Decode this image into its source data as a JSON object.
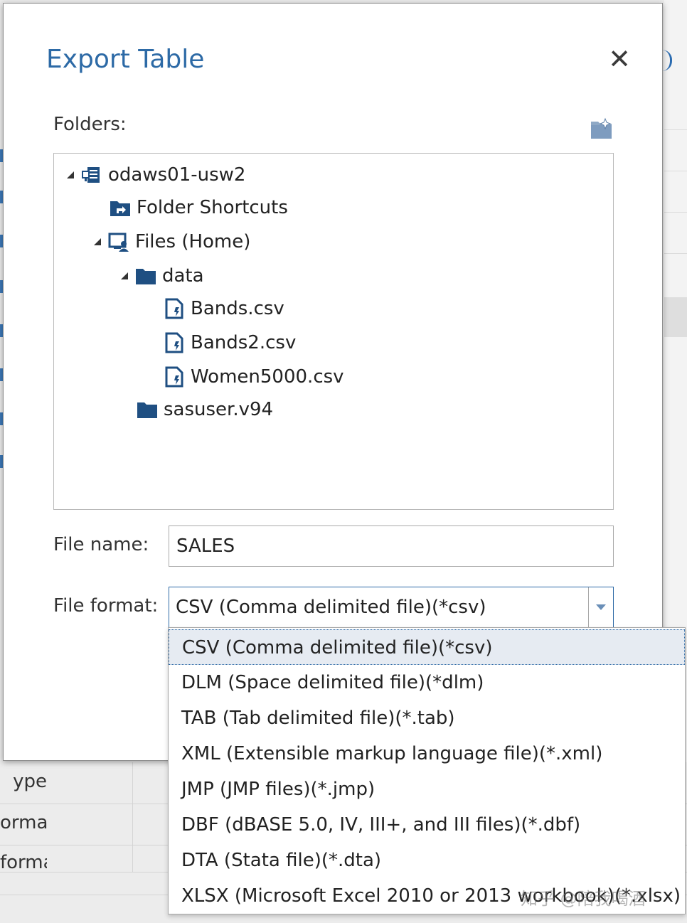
{
  "dialog": {
    "title": "Export Table",
    "close_symbol": "✕",
    "folders_label": "Folders:",
    "new_folder_icon": "new-folder-icon"
  },
  "tree": [
    {
      "label": "odaws01-usw2",
      "icon": "server-icon",
      "expanded": true
    },
    {
      "label": "Folder Shortcuts",
      "icon": "folder-shortcut-icon"
    },
    {
      "label": "Files (Home)",
      "icon": "home-files-icon",
      "expanded": true
    },
    {
      "label": "data",
      "icon": "folder-icon",
      "expanded": true
    },
    {
      "label": "Bands.csv",
      "icon": "file-icon"
    },
    {
      "label": "Bands2.csv",
      "icon": "file-icon"
    },
    {
      "label": "Women5000.csv",
      "icon": "file-icon"
    },
    {
      "label": "sasuser.v94",
      "icon": "folder-icon"
    }
  ],
  "file_name": {
    "label": "File name:",
    "value": "SALES"
  },
  "file_format": {
    "label": "File format:",
    "selected": "CSV (Comma delimited file)(*csv)",
    "options": [
      "CSV (Comma delimited file)(*csv)",
      "DLM (Space delimited file)(*dlm)",
      "TAB (Tab delimited file)(*.tab)",
      "XML (Extensible markup language file)(*.xml)",
      "JMP (JMP files)(*.jmp)",
      "DBF (dBASE 5.0, IV, III+, and III files)(*.dbf)",
      "DTA (Stata file)(*.dta)",
      "XLSX (Microsoft Excel 2010 or 2013 workbook)(*.xlsx)"
    ]
  },
  "background": {
    "rows": [
      "ype",
      "ormat",
      "format"
    ]
  },
  "watermark": "知乎 @陪我喝酒",
  "colors": {
    "accent": "#2d6aa6",
    "selected_option_bg": "#e6ebf2",
    "folder_fill": "#1f4f82"
  }
}
